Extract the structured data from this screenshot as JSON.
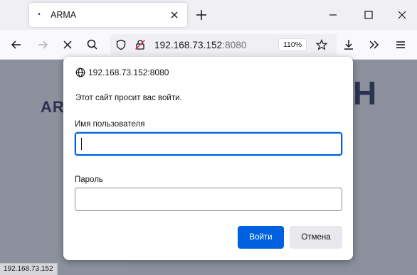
{
  "tab": {
    "title": "ARMA",
    "favicon": "dot-icon"
  },
  "toolbar": {
    "url_host": "192.168.73.152",
    "url_port": ":8080",
    "zoom": "110%"
  },
  "page": {
    "brand_left": "AR",
    "brand_right": "H",
    "status_url": "192.168.73.152"
  },
  "dialog": {
    "origin": "192.168.73.152:8080",
    "prompt": "Этот сайт просит вас войти.",
    "username_label": "Имя пользователя",
    "username_value": "",
    "password_label": "Пароль",
    "password_value": "",
    "ok_label": "Войти",
    "cancel_label": "Отмена"
  },
  "colors": {
    "accent": "#0061e0",
    "dim_overlay": "#8c8f9c",
    "brand": "#2a3350"
  }
}
